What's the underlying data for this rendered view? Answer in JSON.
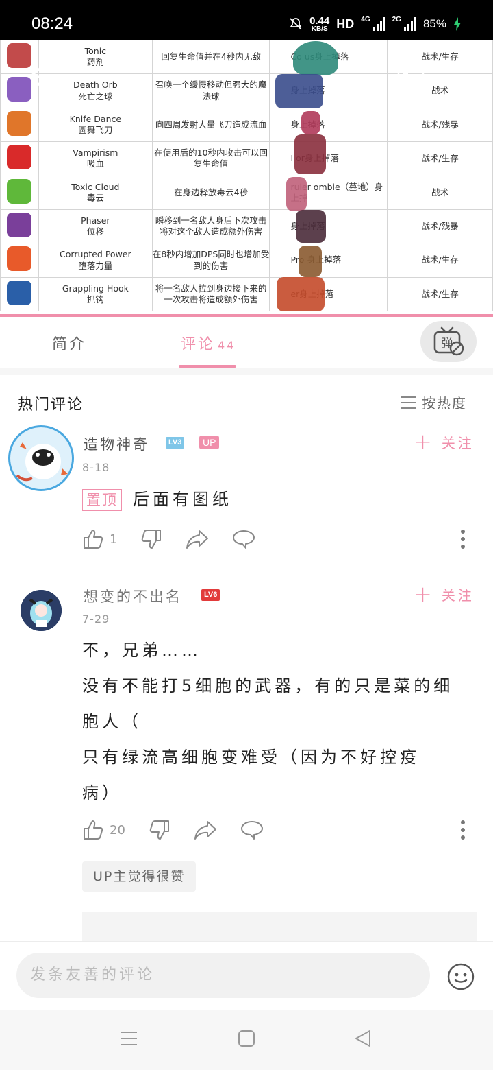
{
  "status_bar": {
    "time": "08:24",
    "speed_value": "0.44",
    "speed_unit": "KB/S",
    "hd": "HD",
    "net1": "4G",
    "net2": "2G",
    "battery": "85%"
  },
  "video_table": {
    "rows": [
      {
        "name_en": "Tonic",
        "name_cn": "药剂",
        "desc": "回复生命值并在4秒内无敌",
        "src": "Co          us身上掉落",
        "tag": "战术/生存"
      },
      {
        "name_en": "Death Orb",
        "name_cn": "死亡之球",
        "desc": "召唤一个缓慢移动但强大的魔法球",
        "src": "身上掉落",
        "tag": "战术"
      },
      {
        "name_en": "Knife Dance",
        "name_cn": "圆舞飞刀",
        "desc": "向四周发射大量飞刀造成流血",
        "src": "身上掉落",
        "tag": "战术/残暴"
      },
      {
        "name_en": "Vampirism",
        "name_cn": "吸血",
        "desc": "在使用后的10秒内攻击可以回复生命值",
        "src": "I        or身上掉落",
        "tag": "战术/生存"
      },
      {
        "name_en": "Toxic Cloud",
        "name_cn": "毒云",
        "desc": "在身边释放毒云4秒",
        "src": "ruler    ombie（墓地）身上掉",
        "tag": "战术"
      },
      {
        "name_en": "Phaser",
        "name_cn": "位移",
        "desc": "瞬移到一名敌人身后下次攻击将对这个敌人造成额外伤害",
        "src": "身上掉落",
        "tag": "战术/残暴"
      },
      {
        "name_en": "Corrupted Power",
        "name_cn": "堕落力量",
        "desc": "在8秒内增加DPS同时也增加受到的伤害",
        "src": "Pro      身上掉落",
        "tag": "战术/生存"
      },
      {
        "name_en": "Grappling Hook",
        "name_cn": "抓钩",
        "desc": "将一名敌人拉到身边接下来的一次攻击将造成额外伤害",
        "src": "er身上掉落",
        "tag": "战术/生存"
      }
    ]
  },
  "tabs": {
    "intro": "简介",
    "comments": "评论",
    "comments_count": "44",
    "danmaku": "弹"
  },
  "hot": {
    "title": "热门评论",
    "sort_label": "按热度"
  },
  "comments": [
    {
      "user": "造物神奇",
      "level": "LV3",
      "up_badge": "UP",
      "date": "8-18",
      "follow": "关注",
      "pin": "置顶",
      "text": "后面有图纸",
      "likes": "1"
    },
    {
      "user": "想变的不出名",
      "level": "LV6",
      "date": "7-29",
      "follow": "关注",
      "lines": [
        "不，兄弟……",
        "没有不能打5细胞的武器，有的只是菜的细",
        "胞人（",
        "只有绿流高细胞变难受（因为不好控疫",
        "病）"
      ],
      "likes": "20",
      "reply_chip": "UP主觉得很赞"
    }
  ],
  "input": {
    "placeholder": "发条友善的评论"
  },
  "colors": {
    "accent": "#f08fab",
    "muted": "#999999"
  }
}
